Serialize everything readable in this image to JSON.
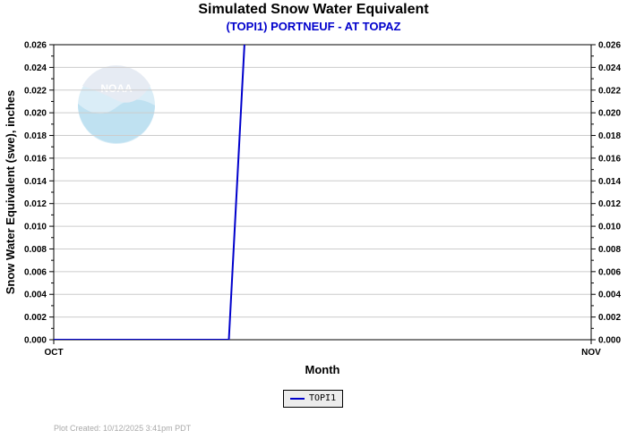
{
  "header": {
    "title": "Simulated Snow Water Equivalent",
    "subtitle": "(TOPI1) PORTNEUF - AT TOPAZ"
  },
  "logo_text": "NOAA",
  "legend": {
    "label": "TOPI1"
  },
  "footer": {
    "text": "Plot Created:  10/12/2025 3:41pm PDT"
  },
  "colors": {
    "series": "#0000cc",
    "grid": "#cccccc",
    "logo": "#cfe6f3"
  },
  "chart_data": {
    "type": "line",
    "title": "Simulated Snow Water Equivalent",
    "subtitle": "(TOPI1) PORTNEUF - AT TOPAZ",
    "xlabel": "Month",
    "ylabel": "Snow Water Equivalent (swe),  inches",
    "x_tick_labels": [
      "OCT",
      "NOV"
    ],
    "xlim": [
      0,
      31
    ],
    "ylim": [
      0,
      0.026
    ],
    "y_ticks": [
      0,
      0.002,
      0.004,
      0.006,
      0.008,
      0.01,
      0.012,
      0.014,
      0.016,
      0.018,
      0.02,
      0.022,
      0.024,
      0.026
    ],
    "y_tick_labels": [
      "0.000",
      "0.002",
      "0.004",
      "0.006",
      "0.008",
      "0.010",
      "0.012",
      "0.014",
      "0.016",
      "0.018",
      "0.020",
      "0.022",
      "0.024",
      "0.026"
    ],
    "grid": true,
    "legend_position": "bottom-center",
    "series": [
      {
        "name": "TOPI1",
        "x": [
          0,
          10.1,
          11.0
        ],
        "y": [
          0,
          0,
          0.026
        ]
      }
    ]
  }
}
